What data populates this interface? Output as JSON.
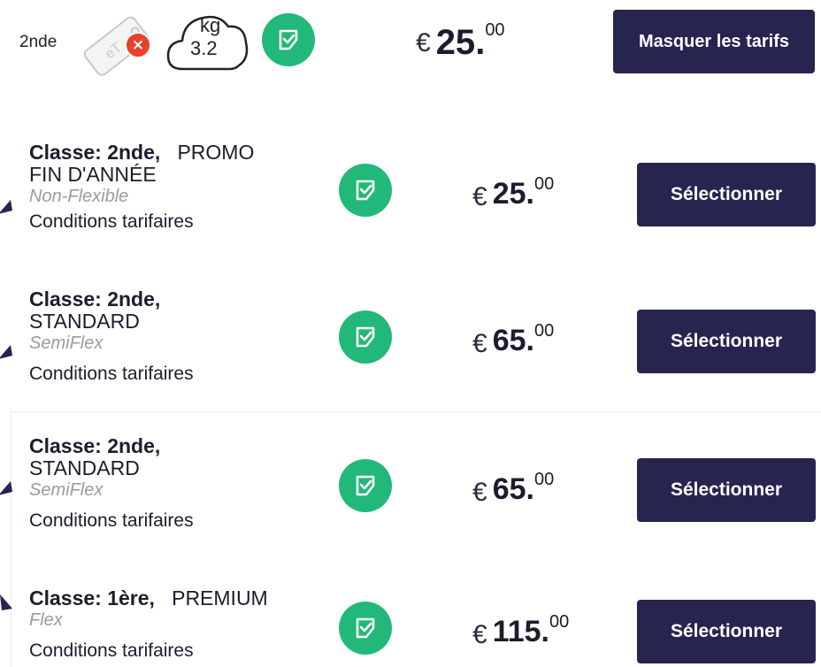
{
  "header": {
    "class_label": "2nde",
    "baggage_weight_unit": "kg",
    "baggage_weight_value": "3.2",
    "price": {
      "currency": "€",
      "integer": "25",
      "decimals": "00"
    },
    "hide_button_label": "Masquer les tarifs",
    "icons": [
      "no-checked-baggage-tag-icon",
      "cabin-bag-weight-icon",
      "fare-check-icon"
    ]
  },
  "fares": [
    {
      "class_label": "Classe: 2nde,",
      "name": "PROMO FIN D'ANNÉE",
      "name_line1": "PROMO",
      "name_line2": "FIN D'ANNÉE",
      "flexibility": "Non-Flexible",
      "conditions": "Conditions tarifaires",
      "price": {
        "currency": "€",
        "integer": "25",
        "decimals": "00"
      },
      "select_label": "Sélectionner"
    },
    {
      "class_label": "Classe: 2nde,",
      "name": "STANDARD",
      "flexibility": "SemiFlex",
      "conditions": "Conditions tarifaires",
      "price": {
        "currency": "€",
        "integer": "65",
        "decimals": "00"
      },
      "select_label": "Sélectionner"
    },
    {
      "class_label": "Classe: 2nde,",
      "name": "STANDARD",
      "flexibility": "SemiFlex",
      "conditions": "Conditions tarifaires",
      "price": {
        "currency": "€",
        "integer": "65",
        "decimals": "00"
      },
      "select_label": "Sélectionner"
    },
    {
      "class_label": "Classe: 1ère,",
      "name": "PREMIUM",
      "flexibility": "Flex",
      "conditions": "Conditions tarifaires",
      "price": {
        "currency": "€",
        "integer": "115",
        "decimals": "00"
      },
      "select_label": "Sélectionner"
    }
  ],
  "colors": {
    "button": "#272450",
    "check": "#22b87a",
    "error_badge": "#e8412c",
    "muted_text": "#9a9aa6"
  }
}
